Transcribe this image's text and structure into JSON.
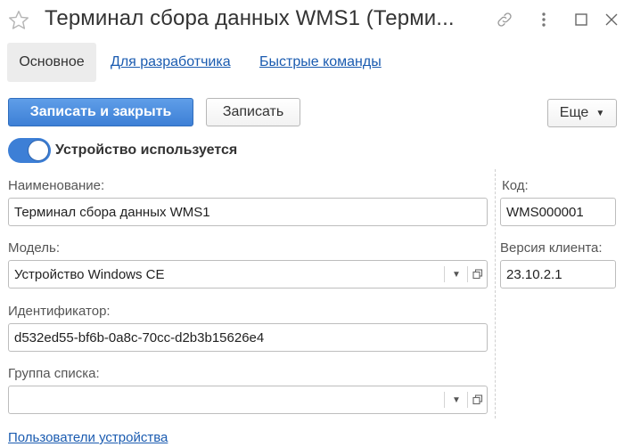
{
  "window": {
    "title": "Терминал сбора данных WMS1 (Терми...",
    "icons": {
      "favorite": "star-icon",
      "link": "link-icon",
      "more": "more-vertical-icon",
      "maximize": "maximize-icon",
      "close": "close-icon"
    }
  },
  "tabs": {
    "main": "Основное",
    "developer": "Для разработчика",
    "quick_commands": "Быстрые команды"
  },
  "toolbar": {
    "save_close": "Записать и закрыть",
    "save": "Записать",
    "more": "Еще"
  },
  "device_toggle": {
    "label": "Устройство используется",
    "on": true
  },
  "form": {
    "name_label": "Наименование:",
    "name_value": "Терминал сбора данных WMS1",
    "model_label": "Модель:",
    "model_value": "Устройство Windows CE",
    "identifier_label": "Идентификатор:",
    "identifier_value": "d532ed55-bf6b-0a8c-70cc-d2b3b15626e4",
    "group_label": "Группа списка:",
    "group_value": "",
    "code_label": "Код:",
    "code_value": "WMS000001",
    "client_version_label": "Версия клиента:",
    "client_version_value": "23.10.2.1"
  },
  "links": {
    "device_users": "Пользователи устройства"
  },
  "colors": {
    "primary": "#3d80d6",
    "link": "#1a5bb0"
  }
}
